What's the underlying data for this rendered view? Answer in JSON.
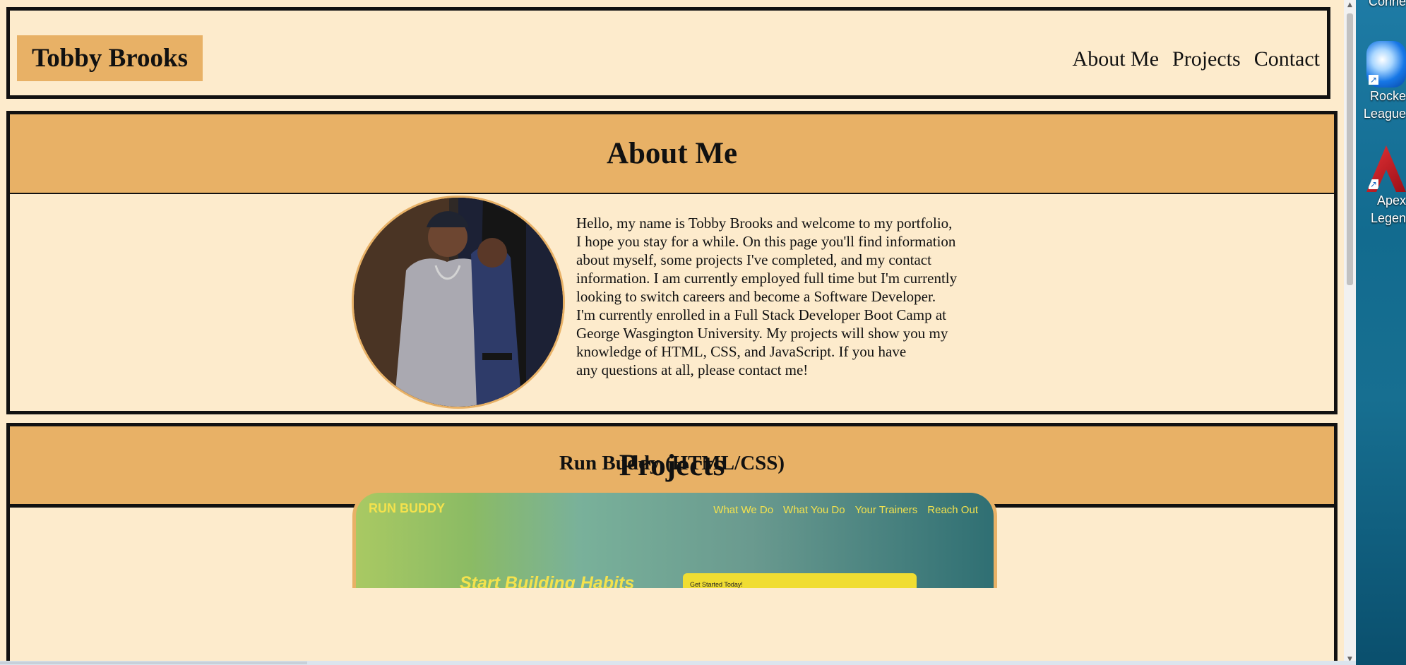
{
  "header": {
    "name": "Tobby Brooks",
    "nav": [
      "About Me",
      "Projects",
      "Contact"
    ]
  },
  "about": {
    "title": "About Me",
    "text": "Hello, my name is Tobby Brooks and welcome to my portfolio,\nI hope you stay for a while. On this page you'll find information\nabout myself, some projects I've completed, and my contact\ninformation. I am currently employed full time but I'm currently\nlooking to switch careers and become a Software Developer.\nI'm currently enrolled in a Full Stack Developer Boot Camp at\nGeorge Wasgington University. My projects will show you my\nknowledge of HTML, CSS, and JavaScript. If you have\nany questions at all, please contact me!"
  },
  "projects": {
    "title": "Projects",
    "items": [
      {
        "title": "Run Buddy (HTML/CSS)",
        "preview": {
          "brand": "RUN BUDDY",
          "links": [
            "What We Do",
            "What You Do",
            "Your Trainers",
            "Reach Out"
          ],
          "headline": "Start Building Habits",
          "form_label": "Get Started Today!"
        }
      }
    ]
  },
  "desktop": {
    "items": [
      "Conne",
      "Rocke League",
      "Apex Legen"
    ]
  },
  "icons": {
    "scroll_up": "▲",
    "scroll_down": "▼",
    "shortcut": "↗"
  },
  "colors": {
    "page_background": "#fdebcc",
    "accent": "#e8b166",
    "border": "#111111",
    "preview_text": "#f4e24d"
  }
}
